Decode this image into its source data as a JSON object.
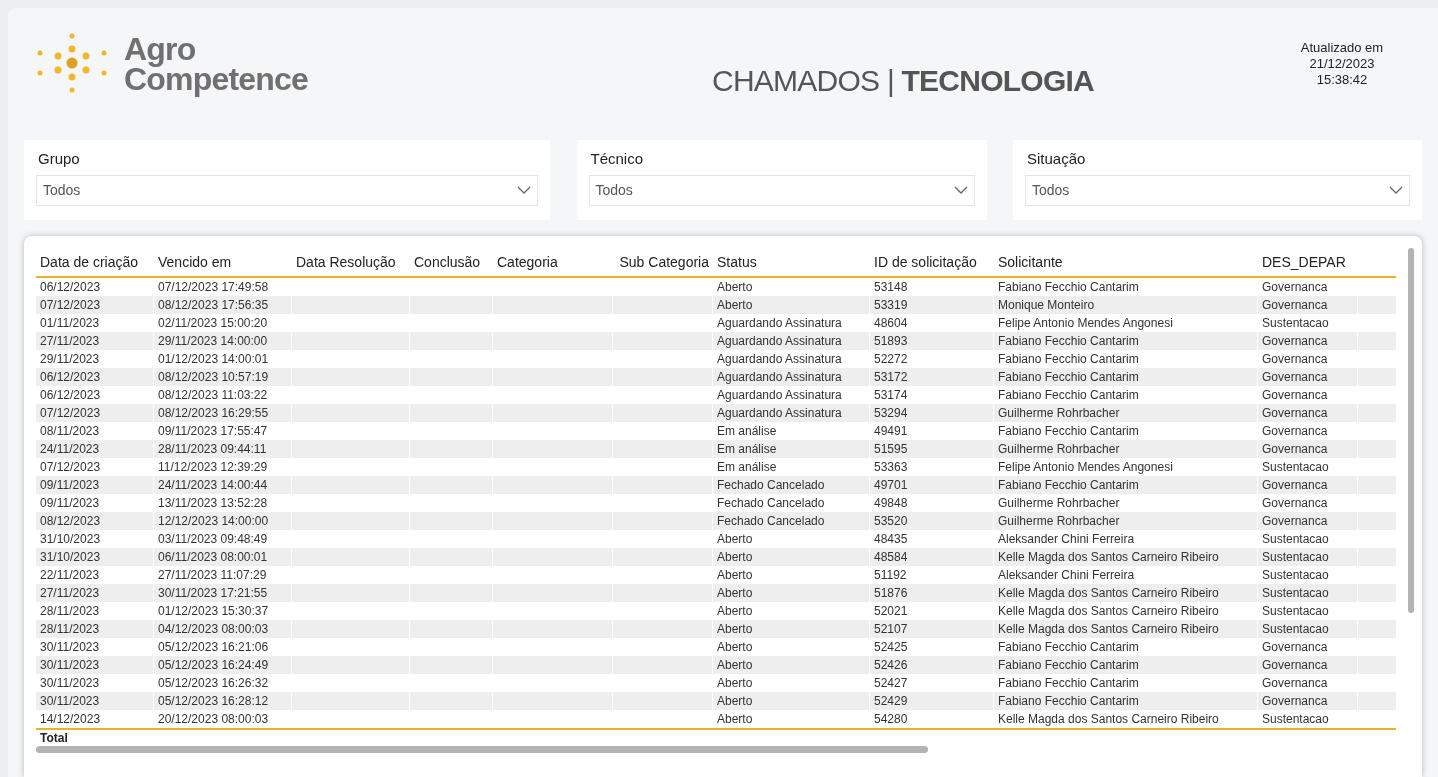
{
  "logo": {
    "line_1": "Agro",
    "line_2": "Competence"
  },
  "title": "CHAMADOS | **TECNOLOGIA**",
  "updated": {
    "label": "Atualizado em",
    "date": "21/12/2023",
    "time": "15:38:42"
  },
  "filters": [
    {
      "label": "Grupo",
      "value": "Todos"
    },
    {
      "label": "Técnico",
      "value": "Todos"
    },
    {
      "label": "Situação",
      "value": "Todos"
    }
  ],
  "table": {
    "columns": [
      "Data de criação",
      "Vencido em",
      "Data Resolução",
      "Conclusão",
      "Categoria",
      "Sub Categoria",
      "Status",
      "ID de solicitação",
      "Solicitante",
      "DES_DEPAR"
    ],
    "rows": [
      [
        "06/12/2023",
        "07/12/2023 17:49:58",
        "",
        "",
        "",
        "",
        "Aberto",
        "53148",
        "Fabiano Fecchio Cantarim",
        "Governanca"
      ],
      [
        "07/12/2023",
        "08/12/2023 17:56:35",
        "",
        "",
        "",
        "",
        "Aberto",
        "53319",
        "Monique Monteiro",
        "Governanca"
      ],
      [
        "01/11/2023",
        "02/11/2023 15:00:20",
        "",
        "",
        "",
        "",
        "Aguardando Assinatura",
        "48604",
        "Felipe Antonio Mendes Angonesi",
        "Sustentacao"
      ],
      [
        "27/11/2023",
        "29/11/2023 14:00:00",
        "",
        "",
        "",
        "",
        "Aguardando Assinatura",
        "51893",
        "Fabiano Fecchio Cantarim",
        "Governanca"
      ],
      [
        "29/11/2023",
        "01/12/2023 14:00:01",
        "",
        "",
        "",
        "",
        "Aguardando Assinatura",
        "52272",
        "Fabiano Fecchio Cantarim",
        "Governanca"
      ],
      [
        "06/12/2023",
        "08/12/2023 10:57:19",
        "",
        "",
        "",
        "",
        "Aguardando Assinatura",
        "53172",
        "Fabiano Fecchio Cantarim",
        "Governanca"
      ],
      [
        "06/12/2023",
        "08/12/2023 11:03:22",
        "",
        "",
        "",
        "",
        "Aguardando Assinatura",
        "53174",
        "Fabiano Fecchio Cantarim",
        "Governanca"
      ],
      [
        "07/12/2023",
        "08/12/2023 16:29:55",
        "",
        "",
        "",
        "",
        "Aguardando Assinatura",
        "53294",
        "Guilherme Rohrbacher",
        "Governanca"
      ],
      [
        "08/11/2023",
        "09/11/2023 17:55:47",
        "",
        "",
        "",
        "",
        "Em análise",
        "49491",
        "Fabiano Fecchio Cantarim",
        "Governanca"
      ],
      [
        "24/11/2023",
        "28/11/2023 09:44:11",
        "",
        "",
        "",
        "",
        "Em análise",
        "51595",
        "Guilherme Rohrbacher",
        "Governanca"
      ],
      [
        "07/12/2023",
        "11/12/2023 12:39:29",
        "",
        "",
        "",
        "",
        "Em análise",
        "53363",
        "Felipe Antonio Mendes Angonesi",
        "Sustentacao"
      ],
      [
        "09/11/2023",
        "24/11/2023 14:00:44",
        "",
        "",
        "",
        "",
        "Fechado Cancelado",
        "49701",
        "Fabiano Fecchio Cantarim",
        "Governanca"
      ],
      [
        "09/11/2023",
        "13/11/2023 13:52:28",
        "",
        "",
        "",
        "",
        "Fechado Cancelado",
        "49848",
        "Guilherme Rohrbacher",
        "Governanca"
      ],
      [
        "08/12/2023",
        "12/12/2023 14:00:00",
        "",
        "",
        "",
        "",
        "Fechado Cancelado",
        "53520",
        "Guilherme Rohrbacher",
        "Governanca"
      ],
      [
        "31/10/2023",
        "03/11/2023 09:48:49",
        "",
        "",
        "",
        "",
        "Aberto",
        "48435",
        "Aleksander Chini Ferreira",
        "Sustentacao"
      ],
      [
        "31/10/2023",
        "06/11/2023 08:00:01",
        "",
        "",
        "",
        "",
        "Aberto",
        "48584",
        "Kelle Magda dos Santos Carneiro Ribeiro",
        "Sustentacao"
      ],
      [
        "22/11/2023",
        "27/11/2023 11:07:29",
        "",
        "",
        "",
        "",
        "Aberto",
        "51192",
        "Aleksander Chini Ferreira",
        "Sustentacao"
      ],
      [
        "27/11/2023",
        "30/11/2023 17:21:55",
        "",
        "",
        "",
        "",
        "Aberto",
        "51876",
        "Kelle Magda dos Santos Carneiro Ribeiro",
        "Sustentacao"
      ],
      [
        "28/11/2023",
        "01/12/2023 15:30:37",
        "",
        "",
        "",
        "",
        "Aberto",
        "52021",
        "Kelle Magda dos Santos Carneiro Ribeiro",
        "Sustentacao"
      ],
      [
        "28/11/2023",
        "04/12/2023 08:00:03",
        "",
        "",
        "",
        "",
        "Aberto",
        "52107",
        "Kelle Magda dos Santos Carneiro Ribeiro",
        "Sustentacao"
      ],
      [
        "30/11/2023",
        "05/12/2023 16:21:06",
        "",
        "",
        "",
        "",
        "Aberto",
        "52425",
        "Fabiano Fecchio Cantarim",
        "Governanca"
      ],
      [
        "30/11/2023",
        "05/12/2023 16:24:49",
        "",
        "",
        "",
        "",
        "Aberto",
        "52426",
        "Fabiano Fecchio Cantarim",
        "Governanca"
      ],
      [
        "30/11/2023",
        "05/12/2023 16:26:32",
        "",
        "",
        "",
        "",
        "Aberto",
        "52427",
        "Fabiano Fecchio Cantarim",
        "Governanca"
      ],
      [
        "30/11/2023",
        "05/12/2023 16:28:12",
        "",
        "",
        "",
        "",
        "Aberto",
        "52429",
        "Fabiano Fecchio Cantarim",
        "Governanca"
      ],
      [
        "14/12/2023",
        "20/12/2023 08:00:03",
        "",
        "",
        "",
        "",
        "Aberto",
        "54280",
        "Kelle Magda dos Santos Carneiro Ribeiro",
        "Sustentacao"
      ]
    ],
    "total_label": "Total"
  }
}
